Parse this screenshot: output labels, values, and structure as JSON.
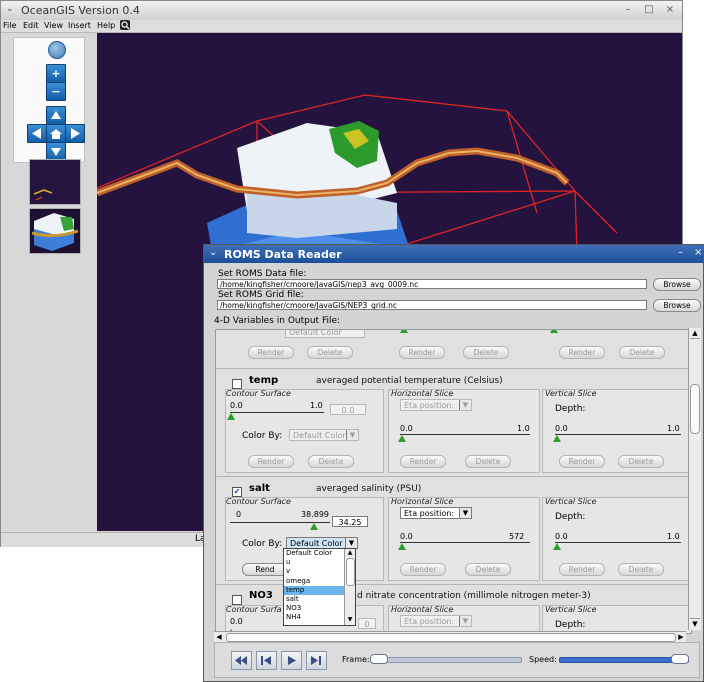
{
  "main_window": {
    "title": "OceanGIS Version 0.4",
    "menu": [
      "File",
      "Edit",
      "View",
      "Insert",
      "Help"
    ],
    "window_buttons": [
      "–",
      "□",
      "×"
    ],
    "status_fragment": "La",
    "nav_icons": [
      "globe-icon",
      "zoom-in-icon",
      "zoom-out-icon",
      "pan-up-icon",
      "pan-left-icon",
      "home-icon",
      "pan-right-icon",
      "pan-down-icon"
    ],
    "zoom_in_glyph": "+",
    "zoom_out_glyph": "−"
  },
  "dialog": {
    "title": "ROMS Data Reader",
    "data_file_label": "Set ROMS Data file:",
    "data_file_path": "/home/kingfisher/cmoore/JavaGIS/nep3_avg_0009.nc",
    "grid_file_label": "Set ROMS Grid file:",
    "grid_file_path": "/home/kingfisher/cmoore/JavaGIS/NEP3_grid.nc",
    "browse_label": "Browse",
    "vars_label": "4-D Variables in Output File:",
    "render_label": "Render",
    "delete_label": "Delete",
    "color_by_label": "Color By:",
    "default_color": "Default Color",
    "eta_position": "Eta position:",
    "depth_label": "Depth:",
    "contour_surface": "Contour Surface",
    "horizontal_slice": "Horizontal Slice",
    "vertical_slice": "Vertical Slice",
    "frame_label": "Frame:",
    "speed_label": "Speed:",
    "variables": [
      {
        "name": "temp",
        "description": "averaged potential temperature (Celsius)",
        "checked": false,
        "contour_min": "0.0",
        "contour_max": "1.0",
        "contour_value": "0.0",
        "h_min": "0.0",
        "h_max": "1.0",
        "v_min": "0.0",
        "v_max": "1.0"
      },
      {
        "name": "salt",
        "description": "averaged salinity (PSU)",
        "checked": true,
        "contour_min": "0",
        "contour_max": "38.899",
        "contour_value": "34.25",
        "h_min": "0.0",
        "h_max": "572",
        "v_min": "0.0",
        "v_max": "1.0"
      },
      {
        "name": "NO3",
        "description": "d nitrate concentration (millimole nitrogen meter-3)",
        "checked": false,
        "contour_min": "0.0",
        "contour_max": "",
        "contour_value": "0",
        "contour_title_fragment": "Contour Surfa"
      }
    ],
    "color_by_options": [
      "Default Color",
      "u",
      "v",
      "omega",
      "temp",
      "salt",
      "NO3",
      "NH4"
    ],
    "selected_option": "temp",
    "check_glyph": "✔",
    "playback_icons": [
      "rewind-icon",
      "step-back-icon",
      "play-icon",
      "step-forward-icon"
    ],
    "render_fragment": "Rend"
  }
}
